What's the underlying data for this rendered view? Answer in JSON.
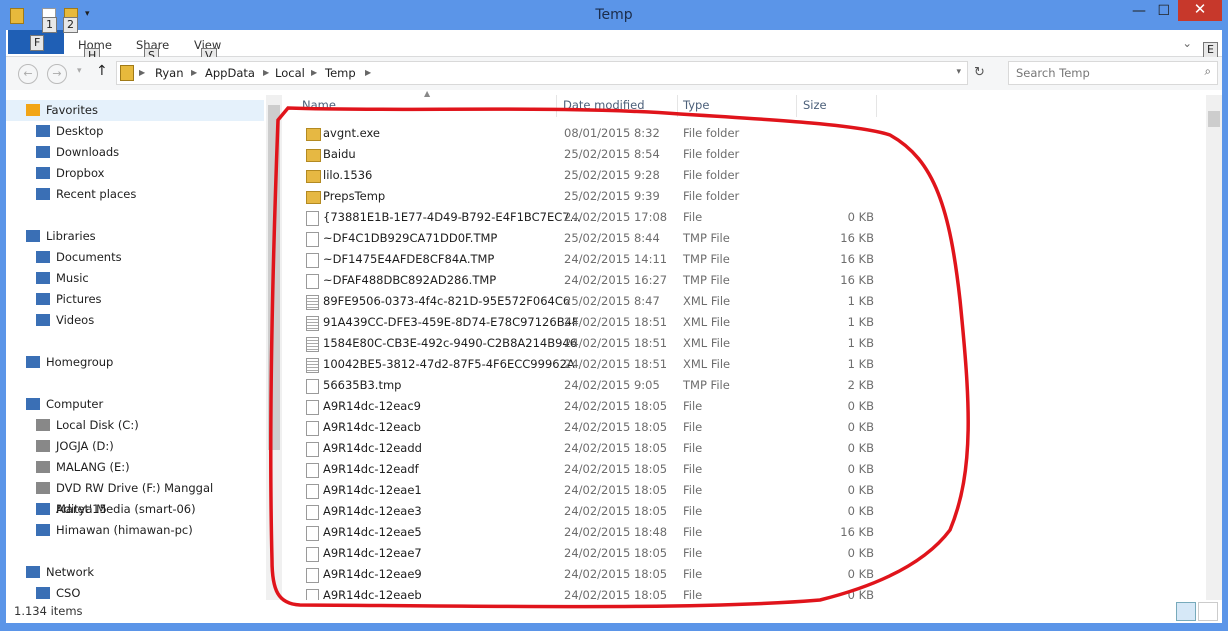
{
  "window": {
    "title": "Temp",
    "close": "✕",
    "minimize": "—",
    "maximize": "☐"
  },
  "quick_access": {
    "keys": [
      "1",
      "2"
    ]
  },
  "ribbon": {
    "file_key": "F",
    "tabs": [
      {
        "label": "Home",
        "key": "H"
      },
      {
        "label": "Share",
        "key": "S"
      },
      {
        "label": "View",
        "key": "V"
      }
    ],
    "help_key": "E"
  },
  "address": {
    "crumbs": [
      "Ryan",
      "AppData",
      "Local",
      "Temp"
    ],
    "search_placeholder": "Search Temp"
  },
  "nav": [
    {
      "label": "Favorites",
      "icon": "star-icon",
      "group": true
    },
    {
      "label": "Desktop",
      "icon": "desktop-icon"
    },
    {
      "label": "Downloads",
      "icon": "downloads-icon"
    },
    {
      "label": "Dropbox",
      "icon": "dropbox-icon"
    },
    {
      "label": "Recent places",
      "icon": "recent-icon"
    },
    {
      "label": "Libraries",
      "icon": "library-icon",
      "group": true
    },
    {
      "label": "Documents",
      "icon": "documents-icon"
    },
    {
      "label": "Music",
      "icon": "music-icon"
    },
    {
      "label": "Pictures",
      "icon": "pictures-icon"
    },
    {
      "label": "Videos",
      "icon": "videos-icon"
    },
    {
      "label": "Homegroup",
      "icon": "homegroup-icon",
      "group": true
    },
    {
      "label": "Computer",
      "icon": "computer-icon",
      "group": true
    },
    {
      "label": "Local Disk (C:)",
      "icon": "disk-icon"
    },
    {
      "label": "JOGJA (D:)",
      "icon": "disk-icon"
    },
    {
      "label": "MALANG (E:)",
      "icon": "disk-icon"
    },
    {
      "label": "DVD RW Drive (F:) Manggal Maret'15",
      "icon": "dvd-icon"
    },
    {
      "label": "Aditya Media (smart-06)",
      "icon": "network-drive-icon"
    },
    {
      "label": "Himawan (himawan-pc)",
      "icon": "network-drive-icon"
    },
    {
      "label": "Network",
      "icon": "network-icon",
      "group": true
    },
    {
      "label": "CSO",
      "icon": "computer-icon"
    }
  ],
  "columns": {
    "name": "Name",
    "date": "Date modified",
    "type": "Type",
    "size": "Size"
  },
  "files": [
    {
      "name": "avgnt.exe",
      "date": "08/01/2015 8:32",
      "type": "File folder",
      "size": "",
      "kind": "folder"
    },
    {
      "name": "Baidu",
      "date": "25/02/2015 8:54",
      "type": "File folder",
      "size": "",
      "kind": "folder"
    },
    {
      "name": "lilo.1536",
      "date": "25/02/2015 9:28",
      "type": "File folder",
      "size": "",
      "kind": "folder"
    },
    {
      "name": "PrepsTemp",
      "date": "25/02/2015 9:39",
      "type": "File folder",
      "size": "",
      "kind": "folder"
    },
    {
      "name": "{73881E1B-1E77-4D49-B792-E4F1BC7EC7...",
      "date": "24/02/2015 17:08",
      "type": "File",
      "size": "0 KB",
      "kind": "file"
    },
    {
      "name": "~DF4C1DB929CA71DD0F.TMP",
      "date": "25/02/2015 8:44",
      "type": "TMP File",
      "size": "16 KB",
      "kind": "file"
    },
    {
      "name": "~DF1475E4AFDE8CF84A.TMP",
      "date": "24/02/2015 14:11",
      "type": "TMP File",
      "size": "16 KB",
      "kind": "file"
    },
    {
      "name": "~DFAF488DBC892AD286.TMP",
      "date": "24/02/2015 16:27",
      "type": "TMP File",
      "size": "16 KB",
      "kind": "file"
    },
    {
      "name": "89FE9506-0373-4f4c-821D-95E572F064C6",
      "date": "25/02/2015 8:47",
      "type": "XML File",
      "size": "1 KB",
      "kind": "xml"
    },
    {
      "name": "91A439CC-DFE3-459E-8D74-E78C97126B4F",
      "date": "24/02/2015 18:51",
      "type": "XML File",
      "size": "1 KB",
      "kind": "xml"
    },
    {
      "name": "1584E80C-CB3E-492c-9490-C2B8A214B946",
      "date": "24/02/2015 18:51",
      "type": "XML File",
      "size": "1 KB",
      "kind": "xml"
    },
    {
      "name": "10042BE5-3812-47d2-87F5-4F6ECC99962A",
      "date": "24/02/2015 18:51",
      "type": "XML File",
      "size": "1 KB",
      "kind": "xml"
    },
    {
      "name": "56635B3.tmp",
      "date": "24/02/2015 9:05",
      "type": "TMP File",
      "size": "2 KB",
      "kind": "file"
    },
    {
      "name": "A9R14dc-12eac9",
      "date": "24/02/2015 18:05",
      "type": "File",
      "size": "0 KB",
      "kind": "file"
    },
    {
      "name": "A9R14dc-12eacb",
      "date": "24/02/2015 18:05",
      "type": "File",
      "size": "0 KB",
      "kind": "file"
    },
    {
      "name": "A9R14dc-12eadd",
      "date": "24/02/2015 18:05",
      "type": "File",
      "size": "0 KB",
      "kind": "file"
    },
    {
      "name": "A9R14dc-12eadf",
      "date": "24/02/2015 18:05",
      "type": "File",
      "size": "0 KB",
      "kind": "file"
    },
    {
      "name": "A9R14dc-12eae1",
      "date": "24/02/2015 18:05",
      "type": "File",
      "size": "0 KB",
      "kind": "file"
    },
    {
      "name": "A9R14dc-12eae3",
      "date": "24/02/2015 18:05",
      "type": "File",
      "size": "0 KB",
      "kind": "file"
    },
    {
      "name": "A9R14dc-12eae5",
      "date": "24/02/2015 18:48",
      "type": "File",
      "size": "16 KB",
      "kind": "file"
    },
    {
      "name": "A9R14dc-12eae7",
      "date": "24/02/2015 18:05",
      "type": "File",
      "size": "0 KB",
      "kind": "file"
    },
    {
      "name": "A9R14dc-12eae9",
      "date": "24/02/2015 18:05",
      "type": "File",
      "size": "0 KB",
      "kind": "file"
    },
    {
      "name": "A9R14dc-12eaeb",
      "date": "24/02/2015 18:05",
      "type": "File",
      "size": "0 KB",
      "kind": "file"
    }
  ],
  "status": {
    "items": "1.134 items"
  },
  "colors": {
    "title_bar": "#5b95e8",
    "file_tab": "#1f5fb5",
    "close": "#c7382b",
    "annotation": "#e0141b"
  }
}
